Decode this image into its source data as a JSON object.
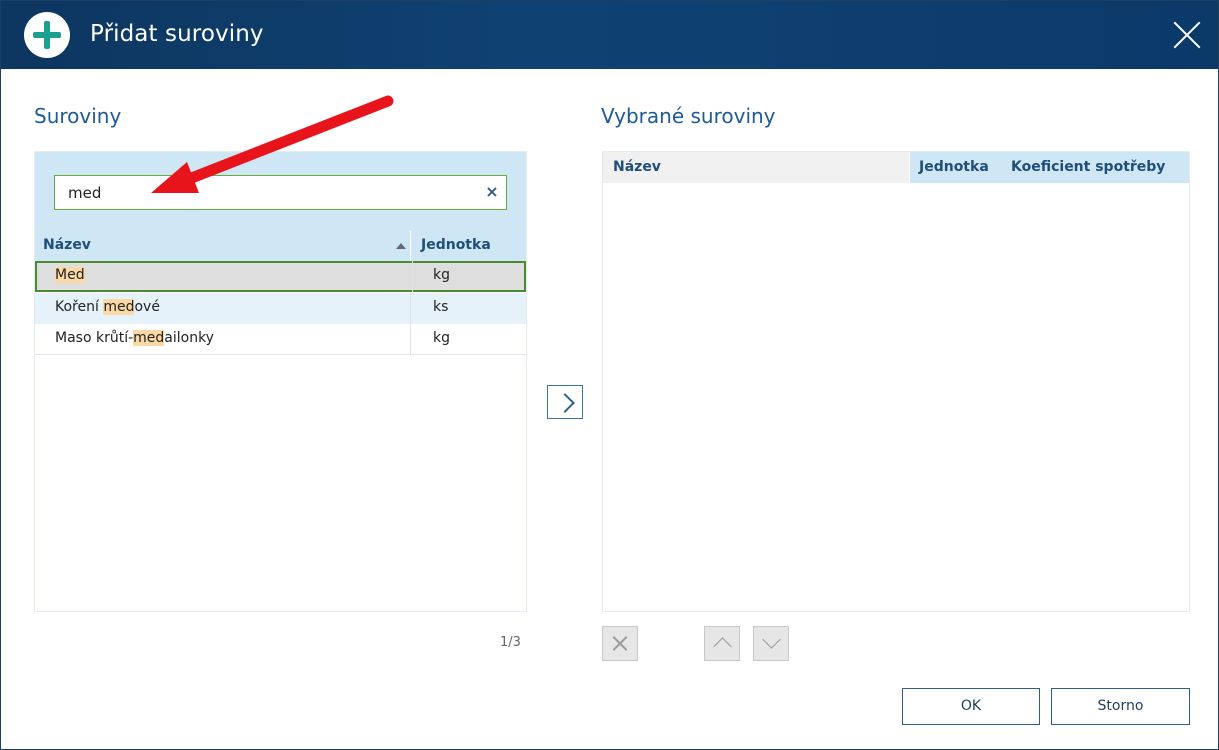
{
  "window": {
    "title": "Přidat suroviny"
  },
  "left": {
    "title": "Suroviny",
    "search": {
      "value": "med",
      "clear_symbol": "×"
    },
    "columns": {
      "name": "Název",
      "unit": "Jednotka"
    },
    "rows": [
      {
        "pre": "",
        "match": "Med",
        "post": "",
        "unit": "kg",
        "selected": true
      },
      {
        "pre": "Koření ",
        "match": "med",
        "post": "ové",
        "unit": "ks"
      },
      {
        "pre": "Maso krůtí-",
        "match": "med",
        "post": "ailonky",
        "unit": "kg"
      }
    ],
    "counter": "1/3"
  },
  "right": {
    "title": "Vybrané suroviny",
    "columns": {
      "name": "Název",
      "unit": "Jednotka",
      "coef": "Koeficient spotřeby"
    }
  },
  "buttons": {
    "ok": "OK",
    "cancel": "Storno"
  },
  "colors": {
    "titlebar": "#0f4273",
    "accent": "#1aa08f",
    "highlight": "#fbd9a6",
    "selection_border": "#4b8a2e",
    "annotation_arrow": "#e8141b"
  }
}
